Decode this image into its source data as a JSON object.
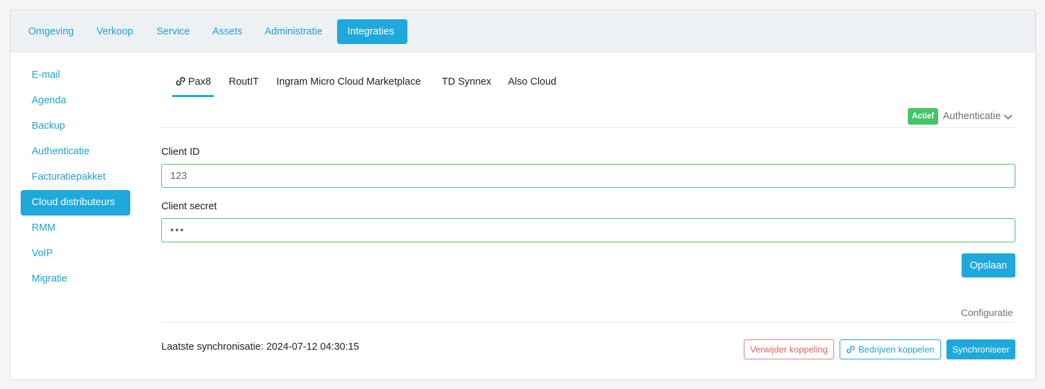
{
  "topnav": {
    "items": [
      {
        "label": "Omgeving"
      },
      {
        "label": "Verkoop"
      },
      {
        "label": "Service"
      },
      {
        "label": "Assets"
      },
      {
        "label": "Administratie"
      },
      {
        "label": "Integraties",
        "active": true
      }
    ]
  },
  "sidebar": {
    "items": [
      {
        "label": "E-mail"
      },
      {
        "label": "Agenda"
      },
      {
        "label": "Backup"
      },
      {
        "label": "Authenticatie"
      },
      {
        "label": "Facturatiepakket"
      },
      {
        "label": "Cloud distributeurs",
        "active": true
      },
      {
        "label": "RMM"
      },
      {
        "label": "VoIP"
      },
      {
        "label": "Migratie"
      }
    ]
  },
  "subtabs": {
    "items": [
      {
        "label": "Pax8",
        "active": true,
        "icon": "link-icon"
      },
      {
        "label": "RoutIT"
      },
      {
        "label": "Ingram Micro Cloud Marketplace"
      },
      {
        "label": "TD Synnex"
      },
      {
        "label": "Also Cloud"
      }
    ]
  },
  "auth_section": {
    "status_badge": "Actief",
    "title": "Authenticatie",
    "toggle_icon": "chevron-down-icon"
  },
  "form": {
    "client_id": {
      "label": "Client ID",
      "value": "123"
    },
    "client_secret": {
      "label": "Client secret",
      "value": "•••"
    },
    "save_label": "Opslaan"
  },
  "config_section": {
    "title": "Configuratie",
    "last_sync_label": "Laatste synchronisatie:",
    "last_sync_value": "2024-07-12 04:30:15",
    "last_sync_text": "Laatste synchronisatie: 2024-07-12 04:30:15",
    "remove_label": "Verwijder koppeling",
    "link_label": "Bedrijven koppelen",
    "sync_label": "Synchroniseer"
  },
  "colors": {
    "accent": "#1ea8dc",
    "success": "#43c56a",
    "danger": "#e06363",
    "field_border": "#4cbf6a"
  }
}
